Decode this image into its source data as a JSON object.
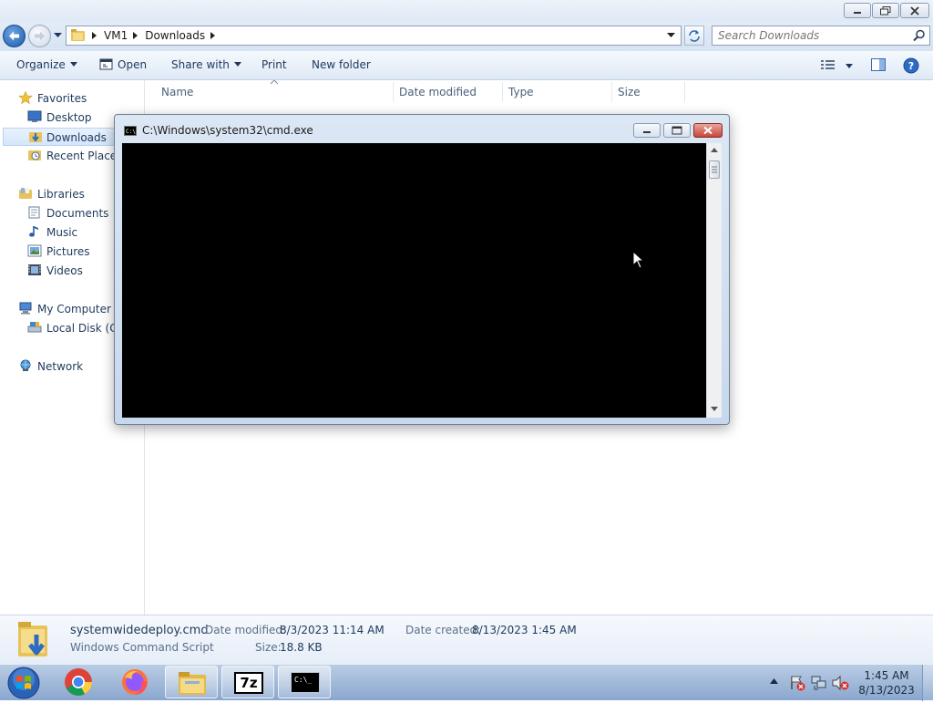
{
  "explorer": {
    "breadcrumb": [
      "VM1",
      "Downloads"
    ],
    "search_placeholder": "Search Downloads",
    "toolbar": {
      "organize": "Organize",
      "open": "Open",
      "share_with": "Share with",
      "print": "Print",
      "new_folder": "New folder"
    },
    "nav": {
      "favorites": "Favorites",
      "desktop": "Desktop",
      "downloads": "Downloads",
      "recent_places": "Recent Places",
      "libraries": "Libraries",
      "documents": "Documents",
      "music": "Music",
      "pictures": "Pictures",
      "videos": "Videos",
      "my_computer": "My Computer",
      "local_disk": "Local Disk (C:)",
      "network": "Network"
    },
    "columns": {
      "name": "Name",
      "date_modified": "Date modified",
      "type": "Type",
      "size": "Size"
    },
    "details": {
      "filename": "systemwidedeploy.cmd",
      "filetype": "Windows Command Script",
      "date_modified_label": "Date modified:",
      "date_modified": "8/3/2023 11:14 AM",
      "date_created_label": "Date created:",
      "date_created": "8/13/2023 1:45 AM",
      "size_label": "Size:",
      "size": "18.8 KB"
    }
  },
  "cmd_window": {
    "title": "C:\\Windows\\system32\\cmd.exe"
  },
  "taskbar": {
    "apps": [
      "start-orb",
      "chrome",
      "firefox",
      "file-explorer",
      "7-zip",
      "command-prompt"
    ],
    "seven_zip_label": "7z",
    "cmd_icon_text": "C:\\_",
    "clock_time": "1:45 AM",
    "clock_date": "8/13/2023"
  },
  "colors": {
    "text_blue": "#1e395b",
    "console_bg": "#000000",
    "close_red": "#c7463c",
    "taskbar": "#9db6d9"
  }
}
